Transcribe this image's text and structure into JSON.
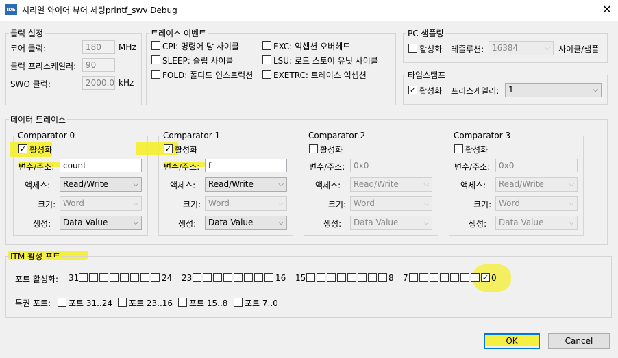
{
  "window": {
    "title": "시리얼 와이어 뷰어 세팅printf_swv Debug",
    "icon_text": "IDE",
    "close_glyph": "✕"
  },
  "clock": {
    "legend": "클럭 설정",
    "core_label": "코어 클럭:",
    "core_value": "180",
    "core_unit": "MHz",
    "prescaler_label": "클럭 프리스케일러:",
    "prescaler_value": "90",
    "swo_label": "SWO 클럭:",
    "swo_value": "2000.0",
    "swo_unit": "kHz"
  },
  "trace_events": {
    "legend": "트레이스 이벤트",
    "items": [
      {
        "label": "CPI: 명령어 당 사이클",
        "checked": false
      },
      {
        "label": "EXC: 익셉션 오버헤드",
        "checked": false
      },
      {
        "label": "SLEEP: 슬립 사이클",
        "checked": false
      },
      {
        "label": "LSU: 로드 스토어 유닛 사이클",
        "checked": false
      },
      {
        "label": "FOLD: 폴디드 인스트럭션",
        "checked": false
      },
      {
        "label": "EXETRC: 트레이스 익셉션",
        "checked": false
      }
    ]
  },
  "pc_sampling": {
    "legend": "PC 샘플링",
    "enable_label": "활성화",
    "enabled": false,
    "resolution_label": "레졸루션:",
    "resolution_value": "16384",
    "unit": "사이클/샘플"
  },
  "timestamp": {
    "legend": "타임스탬프",
    "enable_label": "활성화",
    "enabled": true,
    "prescaler_label": "프리스케일러:",
    "prescaler_value": "1"
  },
  "data_trace": {
    "legend": "데이터 트레이스",
    "field_labels": {
      "enable": "활성화",
      "var": "변수/주소:",
      "access": "액세스:",
      "size": "크기:",
      "gen": "생성:"
    },
    "comparators": [
      {
        "title": "Comparator 0",
        "enabled": true,
        "var_value": "count",
        "access": "Read/Write",
        "size": "Word",
        "gen": "Data Value"
      },
      {
        "title": "Comparator 1",
        "enabled": true,
        "var_value": "f",
        "access": "Read/Write",
        "size": "Word",
        "gen": "Data Value"
      },
      {
        "title": "Comparator 2",
        "enabled": false,
        "var_value": "0x0",
        "access": "Read/Write",
        "size": "Word",
        "gen": "Data Value"
      },
      {
        "title": "Comparator 3",
        "enabled": false,
        "var_value": "0x0",
        "access": "Read/Write",
        "size": "Word",
        "gen": "Data Value"
      }
    ]
  },
  "itm": {
    "legend": "ITM 활성 포트",
    "enable_label": "포트 활성화:",
    "groups": [
      {
        "hi": "31",
        "lo": "24",
        "checked_port_index": -1
      },
      {
        "hi": "23",
        "lo": "16",
        "checked_port_index": -1
      },
      {
        "hi": "15",
        "lo": "8",
        "checked_port_index": -1
      },
      {
        "hi": "7",
        "lo": "0",
        "checked_port_index": 7
      }
    ],
    "privilege_label": "특권 포트:",
    "privilege": [
      {
        "label": "포트 31..24",
        "checked": false
      },
      {
        "label": "포트 23..16",
        "checked": false
      },
      {
        "label": "포트 15..8",
        "checked": false
      },
      {
        "label": "포트 7..0",
        "checked": false
      }
    ]
  },
  "buttons": {
    "ok": "OK",
    "cancel": "Cancel"
  },
  "glyphs": {
    "check": "✓",
    "dropdown": "⌵"
  },
  "colors": {
    "highlight": "#f4ee22",
    "default_button_border": "#0078d7"
  }
}
